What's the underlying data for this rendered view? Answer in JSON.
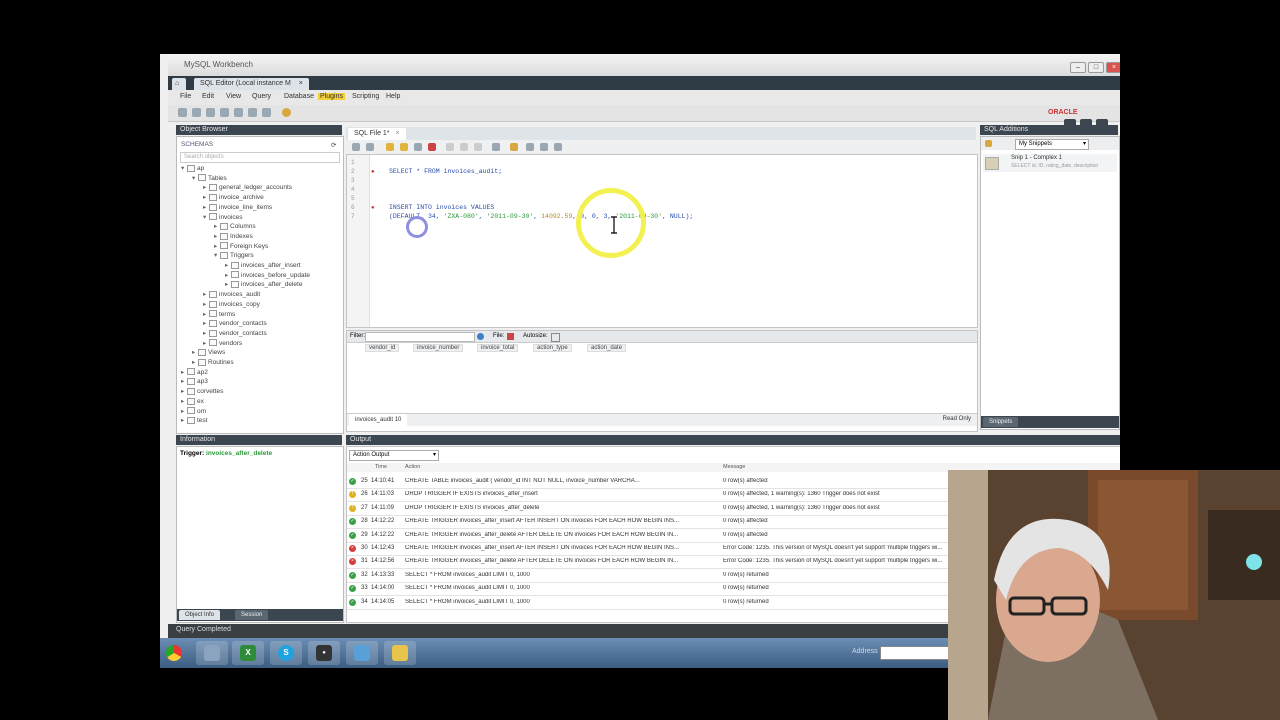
{
  "window": {
    "title": "MySQL Workbench",
    "connection_tab": "SQL Editor (Local instance M",
    "close": "×"
  },
  "menu": [
    "File",
    "Edit",
    "View",
    "Query",
    "Database",
    "Plugins",
    "Scripting",
    "Help"
  ],
  "active_menu_index": 5,
  "oracle_logo": "ORACLE",
  "object_browser": {
    "title": "Object Browser",
    "schemas_label": "SCHEMAS",
    "search_placeholder": "Search objects",
    "tree": [
      {
        "label": "ap",
        "level": 0,
        "expanded": true
      },
      {
        "label": "Tables",
        "level": 1,
        "expanded": true
      },
      {
        "label": "general_ledger_accounts",
        "level": 2
      },
      {
        "label": "invoice_archive",
        "level": 2
      },
      {
        "label": "invoice_line_items",
        "level": 2
      },
      {
        "label": "invoices",
        "level": 2,
        "expanded": true
      },
      {
        "label": "Columns",
        "level": 3
      },
      {
        "label": "Indexes",
        "level": 3
      },
      {
        "label": "Foreign Keys",
        "level": 3
      },
      {
        "label": "Triggers",
        "level": 3,
        "expanded": true
      },
      {
        "label": "invoices_after_insert",
        "level": 4
      },
      {
        "label": "invoices_before_update",
        "level": 4
      },
      {
        "label": "invoices_after_delete",
        "level": 4
      },
      {
        "label": "invoices_audit",
        "level": 2
      },
      {
        "label": "invoices_copy",
        "level": 2
      },
      {
        "label": "terms",
        "level": 2
      },
      {
        "label": "vendor_contacts",
        "level": 2
      },
      {
        "label": "vendor_contacts",
        "level": 2
      },
      {
        "label": "vendors",
        "level": 2
      },
      {
        "label": "Views",
        "level": 1
      },
      {
        "label": "Routines",
        "level": 1
      },
      {
        "label": "ap2",
        "level": 0
      },
      {
        "label": "ap3",
        "level": 0
      },
      {
        "label": "corvettes",
        "level": 0
      },
      {
        "label": "ex",
        "level": 0
      },
      {
        "label": "om",
        "level": 0
      },
      {
        "label": "test",
        "level": 0
      }
    ]
  },
  "editor": {
    "tab_label": "SQL File 1*",
    "close": "×",
    "line_numbers": [
      "1",
      "2",
      "3",
      "4",
      "5",
      "6",
      "7"
    ],
    "line1": "SELECT * FROM invoices_audit;",
    "line6": "INSERT INTO invoices VALUES",
    "line7_parts": [
      "(DEFAULT, 34, ",
      "'ZXA-080'",
      ", ",
      "'2011-09-30'",
      ", ",
      "14092.59",
      ", 0, 0, 3, ",
      "'2011-09-30'",
      ", NULL);"
    ]
  },
  "results": {
    "filter_label": "Filter:",
    "file_label": "File:",
    "autosize_label": "Autosize:",
    "columns": [
      "vendor_id",
      "invoice_number",
      "invoice_total",
      "action_type",
      "action_date"
    ],
    "tab": "invoices_audit 10",
    "read_only": "Read Only"
  },
  "output": {
    "title": "Output",
    "selector": "Action Output",
    "headers": [
      "Time",
      "Action",
      "Message"
    ],
    "rows": [
      {
        "status": "ok",
        "n": "25",
        "time": "14:10:41",
        "action": "CREATE TABLE invoices_audit ( vendor_id     INT          NOT NULL,  invoice_number    VARCHA...",
        "message": "0 row(s) affected"
      },
      {
        "status": "warn",
        "n": "26",
        "time": "14:11:03",
        "action": "DROP TRIGGER IF EXISTS invoices_after_insert",
        "message": "0 row(s) affected, 1 warning(s): 1360 Trigger does not exist"
      },
      {
        "status": "warn",
        "n": "27",
        "time": "14:11:09",
        "action": "DROP TRIGGER IF EXISTS invoices_after_delete",
        "message": "0 row(s) affected, 1 warning(s): 1360 Trigger does not exist"
      },
      {
        "status": "ok",
        "n": "28",
        "time": "14:12:22",
        "action": "CREATE TRIGGER invoices_after_insert   AFTER INSERT ON invoices   FOR EACH ROW BEGIN   INS...",
        "message": "0 row(s) affected"
      },
      {
        "status": "ok",
        "n": "29",
        "time": "14:12:22",
        "action": "CREATE TRIGGER invoices_after_delete   AFTER DELETE ON invoices   FOR EACH ROW BEGIN   IN...",
        "message": "0 row(s) affected"
      },
      {
        "status": "err",
        "n": "30",
        "time": "14:12:43",
        "action": "CREATE TRIGGER invoices_after_insert   AFTER INSERT ON invoices   FOR EACH ROW BEGIN   INS...",
        "message": "Error Code: 1235. This version of MySQL doesn't yet support 'multiple triggers wi..."
      },
      {
        "status": "err",
        "n": "31",
        "time": "14:12:56",
        "action": "CREATE TRIGGER invoices_after_delete   AFTER DELETE ON invoices   FOR EACH ROW BEGIN   IN...",
        "message": "Error Code: 1235. This version of MySQL doesn't yet support 'multiple triggers wi..."
      },
      {
        "status": "ok",
        "n": "32",
        "time": "14:13:33",
        "action": "SELECT * FROM invoices_audit LIMIT 0, 1000",
        "message": "0 row(s) returned"
      },
      {
        "status": "ok",
        "n": "33",
        "time": "14:14:00",
        "action": "SELECT * FROM invoices_audit LIMIT 0, 1000",
        "message": "0 row(s) returned"
      },
      {
        "status": "ok",
        "n": "34",
        "time": "14:14:05",
        "action": "SELECT * FROM invoices_audit LIMIT 0, 1000",
        "message": "0 row(s) returned"
      }
    ]
  },
  "info": {
    "title": "Information",
    "trigger_label": "Trigger:",
    "trigger_name": "invoices_after_delete",
    "tab_object": "Object Info",
    "tab_session": "Session"
  },
  "additions": {
    "title": "SQL Additions",
    "dropdown": "My Snippets",
    "snippet_title": "Snip 1 - Complex 1",
    "snippet_sub": "SELECT id, ID, rating_date, description",
    "tab": "Snippets"
  },
  "status": "Query Completed",
  "taskbar": {
    "address_label": "Address",
    "apps": [
      "chrome",
      "explorer",
      "excel",
      "skype",
      "sony",
      "screen",
      "notes"
    ]
  },
  "colors": {
    "accent_highlight": "#f2f048",
    "menu_active": "#f5cf3a",
    "panel_dark": "#3b4650",
    "taskbar": "#4a6d94"
  }
}
